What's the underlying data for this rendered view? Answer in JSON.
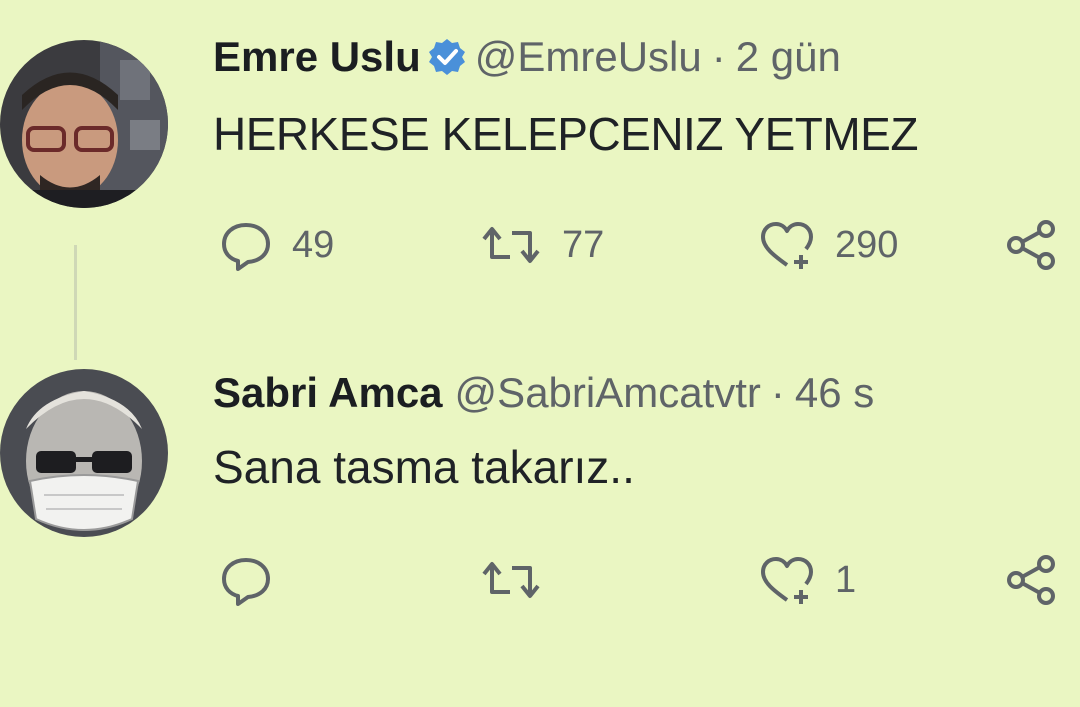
{
  "colors": {
    "background": "#eaf6c2",
    "text": "#1f2226",
    "muted": "#5f6468",
    "verified_badge": "#4a90d9"
  },
  "tweets": [
    {
      "name": "Emre Uslu",
      "verified": true,
      "handle": "@EmreUslu",
      "separator": "·",
      "time": "2 gün",
      "text": "HERKESE KELEPCENIZ YETMEZ",
      "replies": "49",
      "retweets": "77",
      "likes": "290"
    },
    {
      "name": "Sabri Amca",
      "verified": false,
      "handle": "@SabriAmcatvtr",
      "separator": "·",
      "time": "46 s",
      "text": "Sana tasma takarız..",
      "replies": "",
      "retweets": "",
      "likes": "1"
    }
  ],
  "icons": {
    "reply": "speech-bubble-icon",
    "retweet": "retweet-arrows-icon",
    "like": "heart-plus-icon",
    "share": "share-nodes-icon",
    "verified": "verified-badge-icon"
  }
}
